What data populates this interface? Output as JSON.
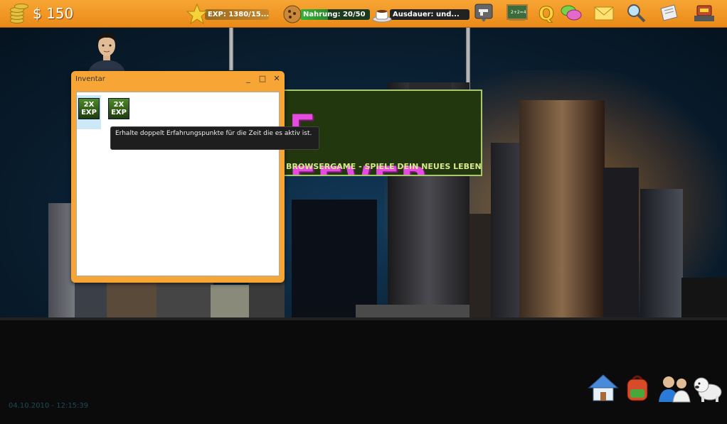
{
  "topbar": {
    "money": "$ 150",
    "exp": "EXP: 1380/15...",
    "food": "Nahrung: 20/50",
    "stamina": "Ausdauer: und..."
  },
  "icons": [
    "coins-icon",
    "star-icon",
    "cookie-icon",
    "coffee-cup-icon",
    "gun-sign-icon",
    "chalkboard-icon",
    "quest-icon",
    "chat-icon",
    "mail-icon",
    "search-icon",
    "newspaper-icon",
    "robot-icon",
    "house-icon",
    "backpack-icon",
    "people-icon",
    "dog-icon"
  ],
  "banner": {
    "title": "E FEVER",
    "subtitle": "BROWSERGAME - SPIELE DEIN NEUES LEBEN"
  },
  "inventory": {
    "title": "Inventar",
    "controls": [
      "_",
      "□",
      "✕"
    ],
    "items": [
      {
        "label": "2X EXP",
        "selected": true
      },
      {
        "label": "2X EXP",
        "selected": false
      }
    ],
    "tooltip": "Erhalte doppelt Erfahrungspunkte für die Zeit die es aktiv ist."
  },
  "footer": {
    "datetime": "04.10.2010 - 12:15:39"
  },
  "colors": {
    "topbar": "#f7a534",
    "exp_bar": "#f5a030",
    "food_bar": "#2e9e2e",
    "stamina_bar": "#222222",
    "banner_text": "#e64be0"
  }
}
